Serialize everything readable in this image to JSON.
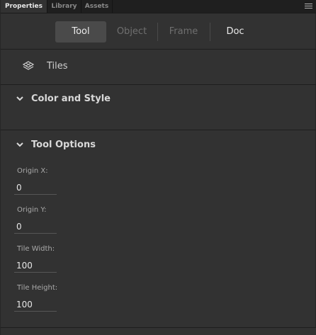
{
  "tabs": [
    {
      "label": "Properties",
      "active": true
    },
    {
      "label": "Library",
      "active": false
    },
    {
      "label": "Assets",
      "active": false
    }
  ],
  "modes": {
    "tool": "Tool",
    "object": "Object",
    "frame": "Frame",
    "doc": "Doc",
    "selected": "Tool"
  },
  "tool_name": "Tiles",
  "sections": {
    "color_style": {
      "title": "Color and Style",
      "expanded": true
    },
    "tool_options": {
      "title": "Tool Options",
      "expanded": true,
      "fields": [
        {
          "label": "Origin X:",
          "value": "0"
        },
        {
          "label": "Origin Y:",
          "value": "0"
        },
        {
          "label": "Tile Width:",
          "value": "100"
        },
        {
          "label": "Tile Height:",
          "value": "100"
        }
      ]
    }
  },
  "colors": {
    "panel_bg": "#323232",
    "tab_strip_bg": "#1f1f1f",
    "selected_mode_bg": "#4a4a4a",
    "text_primary": "#d9d9d9",
    "text_disabled": "#6f6f6f"
  },
  "icons": {
    "panel_menu": "hamburger-icon",
    "tool": "tiles-icon",
    "section_toggle": "chevron-down-icon"
  }
}
